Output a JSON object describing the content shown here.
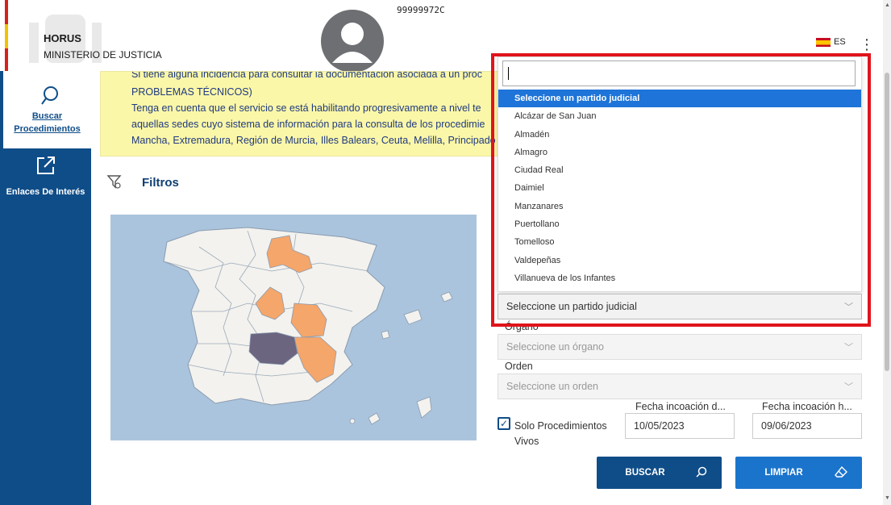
{
  "header": {
    "brand": "HORUS",
    "ministry": "MINISTERIO DE JUSTICIA",
    "user_id": "99999972C",
    "language": "ES",
    "menu_icon": "kebab-menu-icon"
  },
  "sidebar": {
    "items": [
      {
        "label": "Buscar Procedimientos",
        "icon": "search-icon",
        "active": true
      },
      {
        "label": "Enlaces De Interés",
        "icon": "external-link-icon",
        "active": false
      }
    ]
  },
  "notice": {
    "lines": [
      "Si tiene alguna incidencia para consultar la documentación asociada a un proc",
      "PROBLEMAS TÉCNICOS)",
      "Tenga en cuenta que el servicio se está habilitando progresivamente a nivel te",
      "aquellas sedes cuyo sistema de información para la consulta de los procedimie",
      "Mancha, Extremadura, Región de Murcia, Illes Balears, Ceuta, Melilla, Principado"
    ]
  },
  "filters": {
    "title": "Filtros",
    "partido_dropdown": {
      "search_value": "",
      "options": [
        "Seleccione un partido judicial",
        "Alcázar de San Juan",
        "Almadén",
        "Almagro",
        "Ciudad Real",
        "Daimiel",
        "Manzanares",
        "Puertollano",
        "Tomelloso",
        "Valdepeñas",
        "Villanueva de los Infantes"
      ],
      "selected": "Seleccione un partido judicial"
    },
    "organo_label": "Órgano",
    "organo_placeholder": "Seleccione un órgano",
    "orden_label": "Orden",
    "orden_placeholder": "Seleccione un orden",
    "solo_vivos_label": "Solo Procedimientos Vivos",
    "solo_vivos_checked": true,
    "fecha_desde_label": "Fecha incoación d...",
    "fecha_desde_value": "10/05/2023",
    "fecha_hasta_label": "Fecha incoación h...",
    "fecha_hasta_value": "09/06/2023",
    "buscar_label": "BUSCAR",
    "limpiar_label": "LIMPIAR"
  },
  "colors": {
    "primary": "#0f4d88",
    "accent": "#1b74cc",
    "highlight_region": "#f5a66a",
    "selected_region": "#6b6580",
    "notice_bg": "#fbf7a8",
    "annotation_border": "#e0141b"
  }
}
